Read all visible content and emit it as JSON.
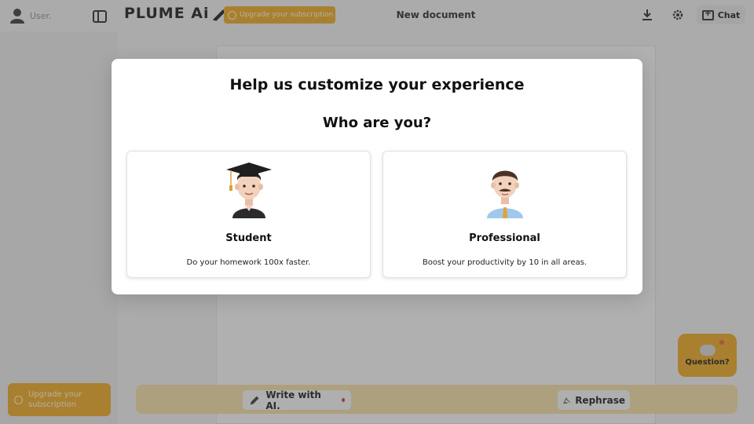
{
  "header": {
    "user_label": "User.",
    "logo_text": "PLUME Ai",
    "upgrade_label": "Upgrade your subscription",
    "document_title": "New document",
    "chat_label": "Chat"
  },
  "sidebar": {
    "upgrade_label": "Upgrade your subscription"
  },
  "bottom_bar": {
    "write_label": "Write with AI.",
    "rephrase_label": "Rephrase"
  },
  "help": {
    "question_label": "Question?"
  },
  "modal": {
    "title": "Help us customize your experience",
    "subtitle": "Who are you?",
    "options": [
      {
        "title": "Student",
        "description": "Do your homework 100x faster.",
        "icon": "student-emoji"
      },
      {
        "title": "Professional",
        "description": "Boost your productivity by 10 in all areas.",
        "icon": "professional-emoji"
      }
    ]
  },
  "colors": {
    "accent": "#e8a317",
    "bottom_bar": "#efd9a0",
    "notification_dot": "#d0342c"
  }
}
